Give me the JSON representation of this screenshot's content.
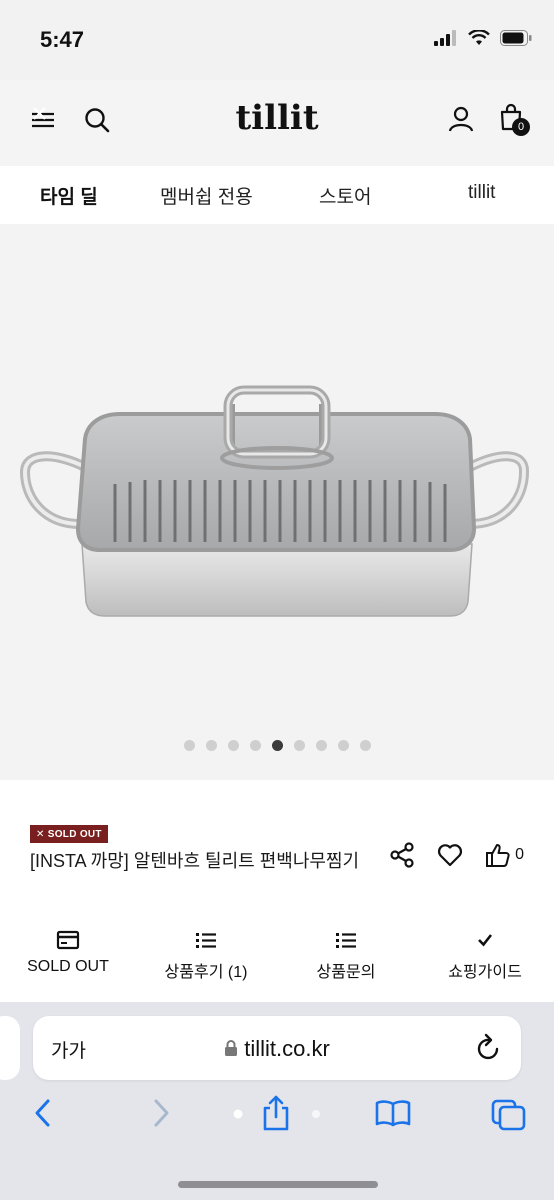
{
  "status": {
    "time": "5:47"
  },
  "header": {
    "logo": "tillit",
    "cart_count": "0"
  },
  "nav": {
    "tabs": [
      "타임 딜",
      "멤버쉽 전용",
      "스토어",
      "tillit"
    ]
  },
  "carousel": {
    "total": 9,
    "active_index": 4
  },
  "product": {
    "badge": "✕ SOLD OUT",
    "title": "[INSTA 까망] 알텐바흐 틸리트 편백나무찜기",
    "like_count": "0"
  },
  "tabs": [
    {
      "label": "SOLD OUT",
      "icon": "card-icon"
    },
    {
      "label": "상품후기 (1)",
      "icon": "list-icon"
    },
    {
      "label": "상품문의",
      "icon": "list-icon"
    },
    {
      "label": "쇼핑가이드",
      "icon": "check-icon"
    }
  ],
  "browser": {
    "text_size": "가가",
    "url": "tillit.co.kr"
  },
  "colors": {
    "badge_bg": "#7a1f1f",
    "accent_blue": "#1a73e8"
  }
}
